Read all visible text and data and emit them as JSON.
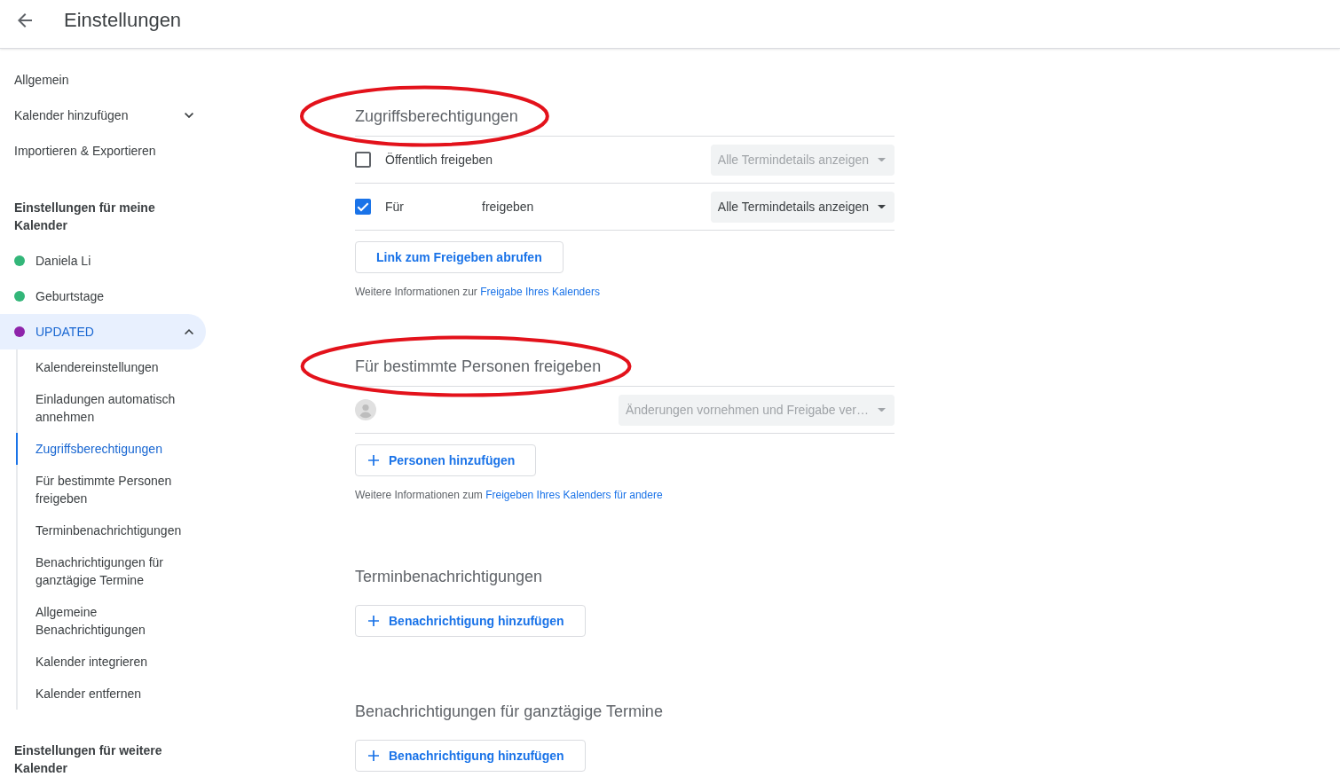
{
  "header": {
    "title": "Einstellungen"
  },
  "sidebar": {
    "items": [
      {
        "label": "Allgemein",
        "kind": "link"
      },
      {
        "label": "Kalender hinzufügen",
        "kind": "expander",
        "expanded": false
      },
      {
        "label": "Importieren & Exportieren",
        "kind": "link"
      }
    ],
    "groups": [
      {
        "heading": "Einstellungen für meine Kalender",
        "calendars": [
          {
            "name": "Daniela Li",
            "color": "#33b679",
            "selected": false
          },
          {
            "name": "Geburtstage",
            "color": "#33b679",
            "selected": false
          },
          {
            "name": "UPDATED",
            "color": "#8e24aa",
            "selected": true,
            "expanded": true,
            "children": [
              {
                "label": "Kalendereinstellungen",
                "selected": false
              },
              {
                "label": "Einladungen automatisch annehmen",
                "selected": false
              },
              {
                "label": "Zugriffsberechtigungen",
                "selected": true
              },
              {
                "label": "Für bestimmte Personen freigeben",
                "selected": false
              },
              {
                "label": "Terminbenachrichtigungen",
                "selected": false
              },
              {
                "label": "Benachrichtigungen für ganztägige Termine",
                "selected": false
              },
              {
                "label": "Allgemeine Benachrichtigungen",
                "selected": false
              },
              {
                "label": "Kalender integrieren",
                "selected": false
              },
              {
                "label": "Kalender entfernen",
                "selected": false
              }
            ]
          }
        ]
      },
      {
        "heading": "Einstellungen für weitere Kalender"
      }
    ]
  },
  "sections": [
    {
      "title": "Zugriffsberechtigungen",
      "circled": true,
      "rows": [
        {
          "kind": "checkbox",
          "checked": false,
          "label": "Öffentlich freigeben",
          "dropdown": {
            "value": "Alle Termindetails anzeigen",
            "disabled": true
          }
        },
        {
          "kind": "checkbox",
          "checked": true,
          "label": "Für",
          "label_after": "freigeben",
          "dropdown": {
            "value": "Alle Termindetails anzeigen",
            "disabled": false
          }
        }
      ],
      "button": {
        "label": "Link zum Freigeben abrufen",
        "kind": "plain"
      },
      "info": {
        "text": "Weitere Informationen zur",
        "link": "Freigabe Ihres Kalenders"
      }
    },
    {
      "title": "Für bestimmte Personen freigeben",
      "circled": true,
      "rows": [
        {
          "kind": "person",
          "dropdown": {
            "value": "Änderungen vornehmen und Freigabe ver…",
            "disabled": true
          }
        }
      ],
      "button": {
        "label": "Personen hinzufügen",
        "kind": "add"
      },
      "info": {
        "text": "Weitere Informationen zum",
        "link": "Freigeben Ihres Kalenders für andere"
      }
    },
    {
      "title": "Terminbenachrichtigungen",
      "circled": false,
      "button": {
        "label": "Benachrichtigung hinzufügen",
        "kind": "add"
      }
    },
    {
      "title": "Benachrichtigungen für ganztägige Termine",
      "circled": false,
      "button": {
        "label": "Benachrichtigung hinzufügen",
        "kind": "add"
      }
    }
  ]
}
